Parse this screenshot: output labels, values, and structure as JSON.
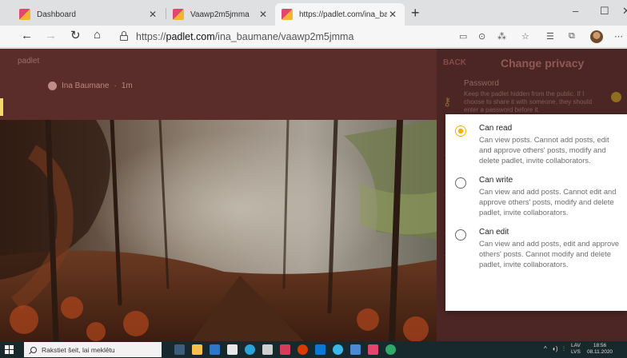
{
  "browser": {
    "tabs": [
      {
        "title": "Dashboard",
        "active": false
      },
      {
        "title": "Vaawp2m5jmma",
        "active": false
      },
      {
        "title": "https://padlet.com/ina_bauman",
        "active": true
      }
    ],
    "new_tab": "+",
    "url_prefix": "https://",
    "url_host": "padlet.com",
    "url_path": "/ina_baumane/vaawp2m5jmma",
    "window_controls": {
      "minimize": "–",
      "maximize": "☐",
      "close": "✕"
    }
  },
  "padlet": {
    "brand": "padlet",
    "author": "Ina Baumane",
    "time": "1m"
  },
  "privacy_panel": {
    "back": "BACK",
    "title": "Change privacy",
    "password_label": "Password",
    "password_desc": "Keep the padlet hidden from the public. If I choose to share it with someone, they should enter a password before it."
  },
  "privacy_options": [
    {
      "title": "Can read",
      "desc": "Can view posts. Cannot add posts, edit and approve others' posts, modify and delete padlet, invite collaborators.",
      "selected": true
    },
    {
      "title": "Can write",
      "desc": "Can view and add posts. Cannot edit and approve others' posts, modify and delete padlet, invite collaborators.",
      "selected": false
    },
    {
      "title": "Can edit",
      "desc": "Can view and add posts, edit and approve others' posts. Cannot modify and delete padlet, invite collaborators.",
      "selected": false
    }
  ],
  "taskbar": {
    "search_placeholder": "Rakstiet šeit, lai meklētu",
    "lang": "LAV",
    "lang2": "LVS",
    "time": "18:56",
    "date": "08.11.2020"
  },
  "colors": {
    "accent": "#f4b400",
    "page_bg": "#5a2d2b",
    "taskbar": "#18292d"
  }
}
